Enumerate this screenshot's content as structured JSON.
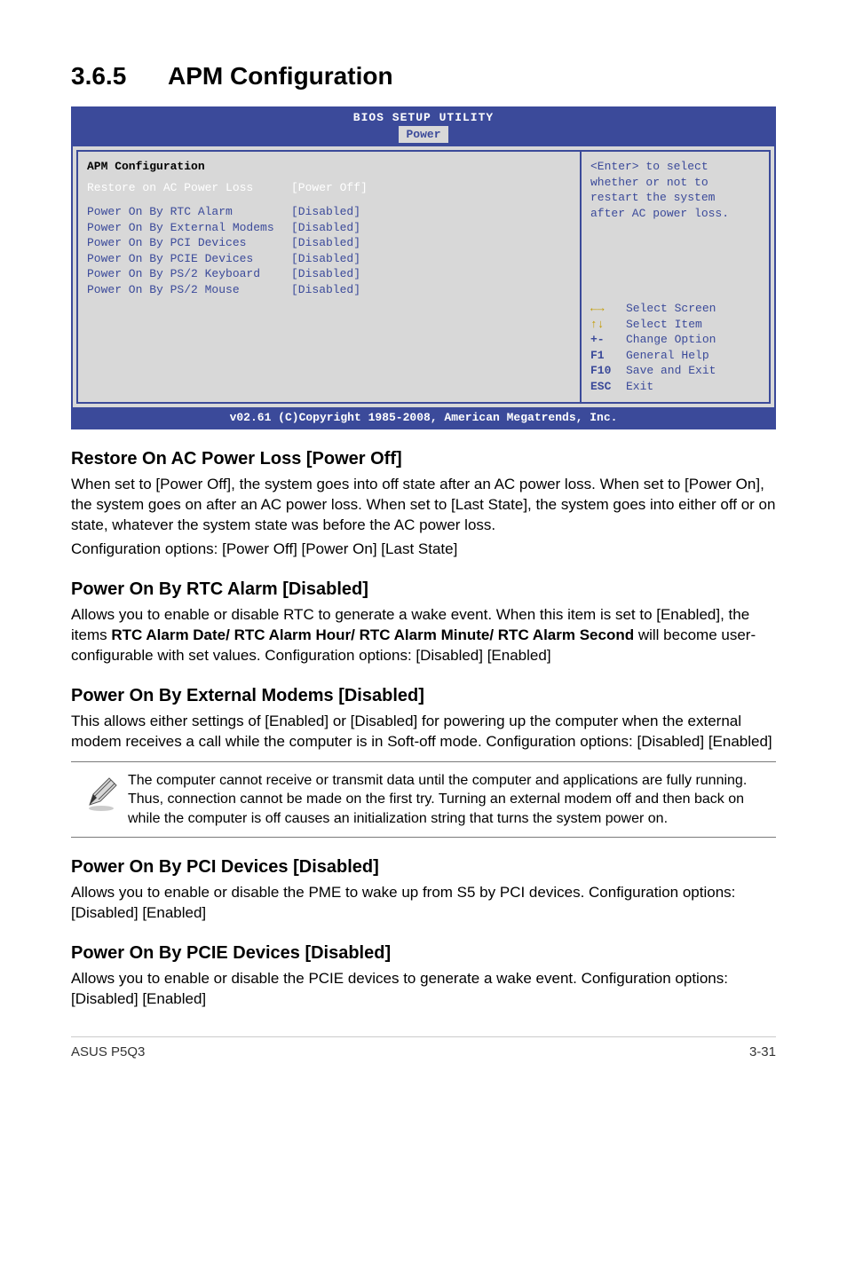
{
  "section": {
    "number": "3.6.5",
    "title": "APM Configuration"
  },
  "bios": {
    "header": "BIOS SETUP UTILITY",
    "tab": "Power",
    "panel_title": "APM Configuration",
    "rows": [
      {
        "label": "Restore on AC Power Loss",
        "value": "[Power Off]",
        "selected": true
      },
      {
        "label": "Power On By RTC Alarm",
        "value": "[Disabled]"
      },
      {
        "label": "Power On By External Modems",
        "value": "[Disabled]"
      },
      {
        "label": "Power On By PCI Devices",
        "value": "[Disabled]"
      },
      {
        "label": "Power On By PCIE Devices",
        "value": "[Disabled]"
      },
      {
        "label": "Power On By PS/2 Keyboard",
        "value": "[Disabled]"
      },
      {
        "label": "Power On By PS/2 Mouse",
        "value": "[Disabled]"
      }
    ],
    "help": {
      "l1": "<Enter> to select",
      "l2": "whether or not to",
      "l3": "restart the system",
      "l4": "after AC power loss."
    },
    "legend": {
      "r1": {
        "k": "←→",
        "t": "Select Screen"
      },
      "r2": {
        "k": "↑↓",
        "t": "Select Item"
      },
      "r3": {
        "k": "+-",
        "t": "Change Option"
      },
      "r4": {
        "k": "F1",
        "t": "General Help"
      },
      "r5": {
        "k": "F10",
        "t": "Save and Exit"
      },
      "r6": {
        "k": "ESC",
        "t": "Exit"
      }
    },
    "footer": "v02.61 (C)Copyright 1985-2008, American Megatrends, Inc."
  },
  "s1": {
    "h": "Restore On AC Power Loss [Power Off]",
    "p1": "When set to [Power Off], the system goes into off state after an AC power loss. When set to [Power On], the system goes on after an AC power loss. When set to [Last State], the system goes into either off or on state, whatever the system state was before the AC power loss.",
    "p2": "Configuration options: [Power Off] [Power On] [Last State]"
  },
  "s2": {
    "h": "Power On By RTC Alarm [Disabled]",
    "p1a": "Allows you to enable or disable RTC to generate a wake event. When this item is set to [Enabled], the items ",
    "p1b": "RTC Alarm Date/ RTC Alarm Hour/ RTC Alarm Minute/ RTC Alarm Second",
    "p1c": " will become user-configurable with set values. Configuration options: [Disabled] [Enabled]"
  },
  "s3": {
    "h": "Power On By External Modems [Disabled]",
    "p1": "This allows either settings of [Enabled] or [Disabled] for powering up the computer when the external modem receives a call while the computer is in Soft-off mode. Configuration options: [Disabled] [Enabled]"
  },
  "note": {
    "text": "The computer cannot receive or transmit data until the computer and applications are fully running. Thus, connection cannot be made on the first try. Turning an external modem off and then back on while the computer is off causes an initialization string that turns the system power on."
  },
  "s4": {
    "h": "Power On By PCI Devices [Disabled]",
    "p1": "Allows you to enable or disable the PME to wake up from S5 by PCI devices. Configuration options: [Disabled] [Enabled]"
  },
  "s5": {
    "h": "Power On By PCIE Devices [Disabled]",
    "p1": "Allows you to enable or disable the PCIE devices to generate a wake event. Configuration options: [Disabled] [Enabled]"
  },
  "footer": {
    "left": "ASUS P5Q3",
    "right": "3-31"
  }
}
